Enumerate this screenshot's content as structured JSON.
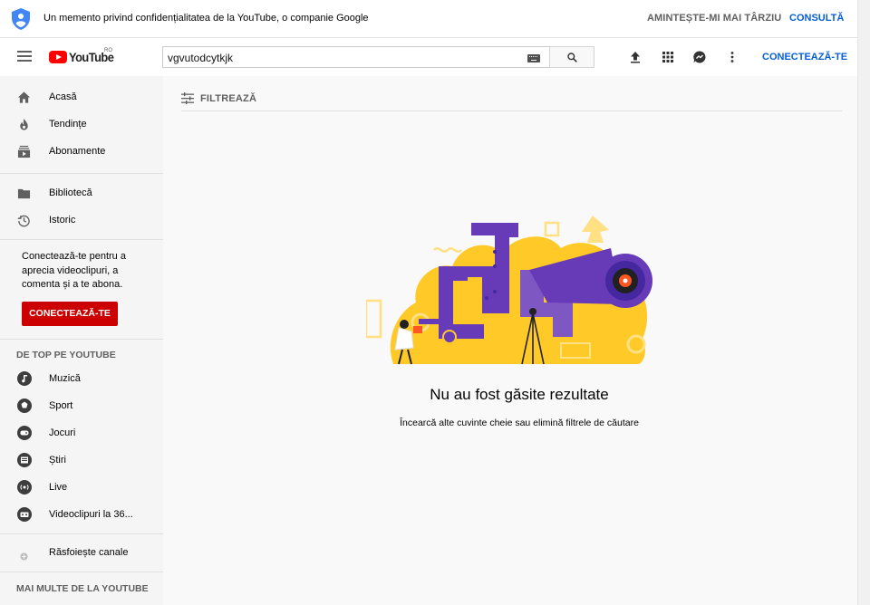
{
  "banner": {
    "message": "Un memento privind confidențialitatea de la YouTube, o companie Google",
    "remind_later": "AMINTEȘTE-MI MAI TÂRZIU",
    "consult": "CONSULTĂ",
    "icon": "shield-person-icon"
  },
  "header": {
    "logo_text": "YouTube",
    "country_code": "RO",
    "search_value": "vgvutodcytkjk",
    "signin_label": "CONECTEAZĂ-TE",
    "icons": [
      "menu-icon",
      "keyboard-icon",
      "search-icon",
      "upload-icon",
      "apps-icon",
      "messages-icon",
      "more-vert-icon"
    ]
  },
  "sidebar": {
    "primary": [
      {
        "label": "Acasă",
        "icon": "home-icon"
      },
      {
        "label": "Tendințe",
        "icon": "flame-icon"
      },
      {
        "label": "Abonamente",
        "icon": "subscriptions-icon"
      }
    ],
    "library": [
      {
        "label": "Bibliotecă",
        "icon": "folder-icon"
      },
      {
        "label": "Istoric",
        "icon": "history-icon"
      }
    ],
    "signin_note": "Conectează-te pentru a aprecia videoclipuri, a comenta și a te abona.",
    "signin_button": "CONECTEAZĂ-TE",
    "top_heading": "DE TOP PE YOUTUBE",
    "top_items": [
      {
        "label": "Muzică",
        "icon": "music-icon"
      },
      {
        "label": "Sport",
        "icon": "sport-icon"
      },
      {
        "label": "Jocuri",
        "icon": "gaming-icon"
      },
      {
        "label": "Știri",
        "icon": "news-icon"
      },
      {
        "label": "Live",
        "icon": "live-icon"
      },
      {
        "label": "Videoclipuri la 36...",
        "icon": "vr-360-icon"
      }
    ],
    "browse_channels": "Răsfoiește canale",
    "more_heading": "MAI MULTE DE LA YOUTUBE"
  },
  "main": {
    "filter_label": "FILTREAZĂ",
    "no_results_title": "Nu au fost găsite rezultate",
    "no_results_hint": "Încearcă alte cuvinte cheie sau elimină filtrele de căutare"
  },
  "colors": {
    "brand_red": "#ff0000",
    "signin_red": "#cc0000",
    "link_blue": "#065fd4",
    "illus_yellow": "#ffca28",
    "illus_purple": "#673ab7"
  }
}
